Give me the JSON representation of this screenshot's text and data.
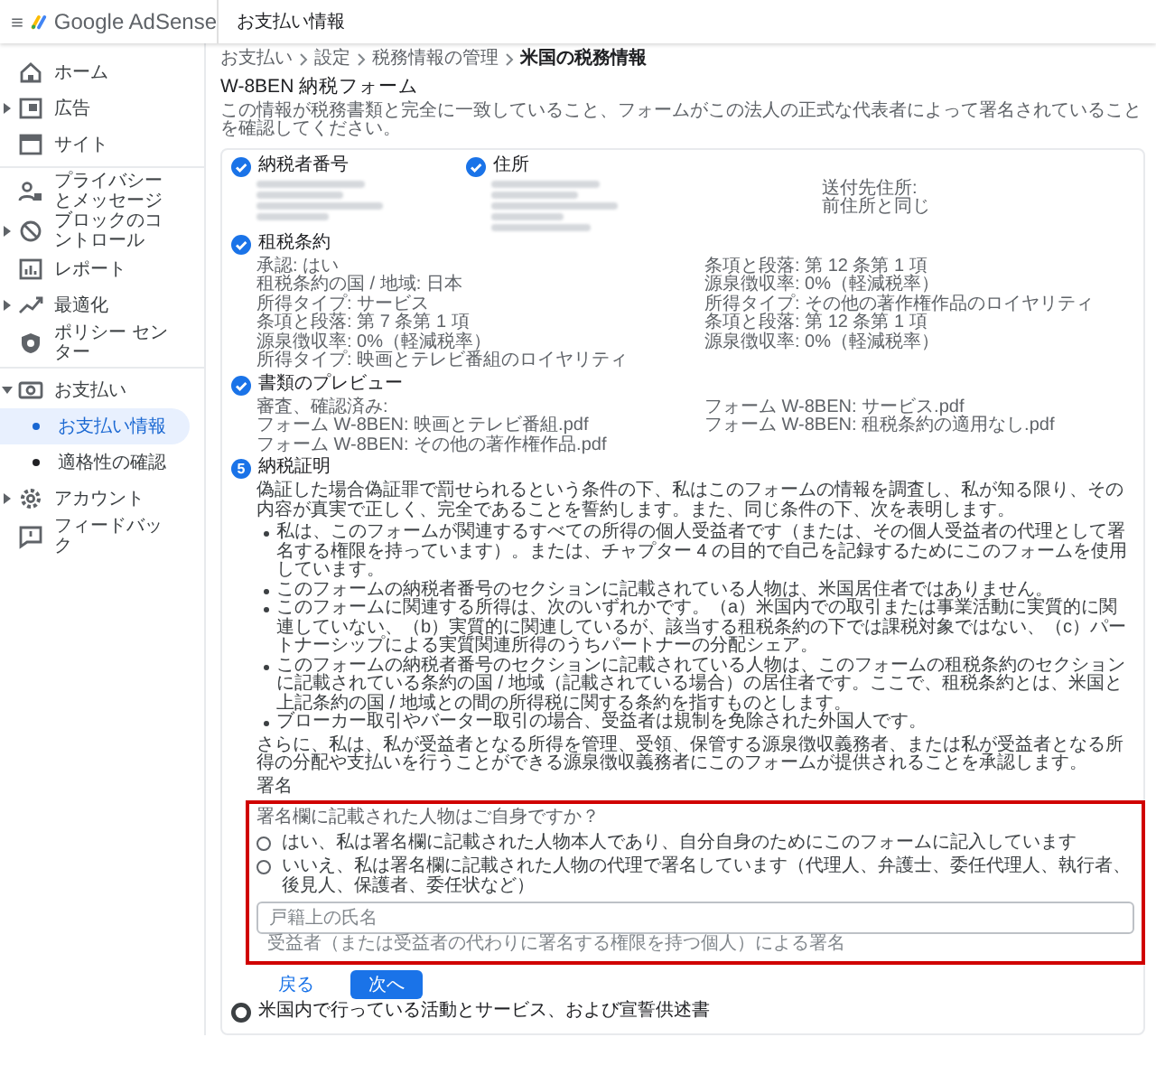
{
  "app": {
    "name": "Google AdSense"
  },
  "header": {
    "title": "お支払い情報"
  },
  "nav_groups": [
    {
      "items": [
        {
          "label": "ホーム",
          "selected": false
        },
        {
          "label": "広告",
          "selected": false,
          "expanded": false
        },
        {
          "label": "サイト",
          "selected": false
        }
      ]
    },
    {
      "items": [
        {
          "label": "プライバシーとメッセージ",
          "selected": false
        },
        {
          "label": "ブロックのコントロール",
          "selected": false,
          "expanded": false
        },
        {
          "label": "レポート",
          "selected": false
        },
        {
          "label": "最適化",
          "selected": false,
          "expanded": false
        },
        {
          "label": "ポリシー センター",
          "selected": false
        }
      ]
    },
    {
      "items": [
        {
          "label": "お支払い",
          "selected": false,
          "expanded": true,
          "children": [
            {
              "label": "お支払い情報",
              "selected": true
            },
            {
              "label": "適格性の確認",
              "selected": false
            }
          ]
        },
        {
          "label": "アカウント",
          "selected": false,
          "expanded": false
        },
        {
          "label": "フィードバック",
          "selected": false
        }
      ]
    }
  ],
  "breadcrumb": [
    "お支払い",
    "設定",
    "税務情報の管理",
    "米国の税務情報"
  ],
  "form_title": "W-8BEN 納税フォーム",
  "form_intro": "この情報が税務書類と完全に一致していること、フォームがこの法人の正式な代表者によって署名されていることを確認してください。",
  "steps": [
    {
      "title": "納税者番号",
      "completed": true,
      "active": false,
      "kind": "redacted"
    },
    {
      "title": "住所",
      "completed": true,
      "active": false,
      "kind": "redacted",
      "aside": [
        "送付先住所:",
        "前住所と同じ"
      ]
    },
    {
      "title": "租税条約",
      "completed": true,
      "active": false,
      "kind": "lines",
      "lines": [
        "承認: はい",
        "租税条約の国 / 地域: 日本",
        "所得タイプ: サービス",
        "条項と段落: 第 7 条第 1 項",
        "源泉徴収率: 0%（軽減税率）",
        "所得タイプ: 映画とテレビ番組のロイヤリティ",
        "条項と段落: 第 12 条第 1 項",
        "源泉徴収率: 0%（軽減税率）",
        "所得タイプ: その他の著作権作品のロイヤリティ",
        "条項と段落: 第 12 条第 1 項",
        "源泉徴収率: 0%（軽減税率）"
      ]
    },
    {
      "title": "書類のプレビュー",
      "completed": true,
      "active": false,
      "kind": "preview",
      "note": "審査、確認済み:",
      "files": [
        "フォーム W-8BEN: 映画とテレビ番組.pdf",
        "フォーム W-8BEN: その他の著作権作品.pdf",
        "フォーム W-8BEN: サービス.pdf",
        "フォーム W-8BEN: 租税条約の適用なし.pdf"
      ]
    },
    {
      "title": "納税証明",
      "completed": false,
      "active": true,
      "number": "5",
      "kind": "certification",
      "intro": "偽証した場合偽証罪で罰せられるという条件の下、私はこのフォームの情報を調査し、私が知る限り、その内容が真実で正しく、完全であることを誓約します。また、同じ条件の下、次を表明します。",
      "bullets": [
        "私は、このフォームが関連するすべての所得の個人受益者です（または、その個人受益者の代理として署名する権限を持っています）。または、チャプター 4 の目的で自己を記録するためにこのフォームを使用しています。",
        "このフォームの納税者番号のセクションに記載されている人物は、米国居住者ではありません。",
        "このフォームに関連する所得は、次のいずれかです。（a）米国内での取引または事業活動に実質的に関連していない、（b）実質的に関連しているが、該当する租税条約の下では課税対象ではない、（c）パートナーシップによる実質関連所得のうちパートナーの分配シェア。",
        "このフォームの納税者番号のセクションに記載されている人物は、このフォームの租税条約のセクションに記載されている条約の国 / 地域（記載されている場合）の居住者です。ここで、租税条約とは、米国と上記条約の国 / 地域との間の所得税に関する条約を指すものとします。",
        "ブローカー取引やバーター取引の場合、受益者は規制を免除された外国人です。"
      ],
      "outro": "さらに、私は、私が受益者となる所得を管理、受領、保管する源泉徴収義務者、または私が受益者となる所得の分配や支払いを行うことができる源泉徴収義務者にこのフォームが提供されることを承認します。",
      "signature_label": "署名",
      "signature_box": {
        "highlighted": true,
        "question": "署名欄に記載された人物はご自身ですか？",
        "options": [
          {
            "label": "はい、私は署名欄に記載された人物本人であり、自分自身のためにこのフォームに記入しています",
            "selected": false
          },
          {
            "label": "いいえ、私は署名欄に記載された人物の代理で署名しています（代理人、弁護士、委任代理人、執行者、後見人、保護者、委任状など）",
            "selected": false
          }
        ],
        "name_field": {
          "placeholder": "戸籍上の氏名",
          "hint": "受益者（または受益者の代わりに署名する権限を持つ個人）による署名"
        }
      },
      "buttons": [
        {
          "label": "戻る",
          "kind": "text"
        },
        {
          "label": "次へ",
          "kind": "primary"
        }
      ]
    },
    {
      "title": "米国内で行っている活動とサービス、および宣誓供述書",
      "completed": false,
      "active": false,
      "kind": "collapsed"
    }
  ]
}
